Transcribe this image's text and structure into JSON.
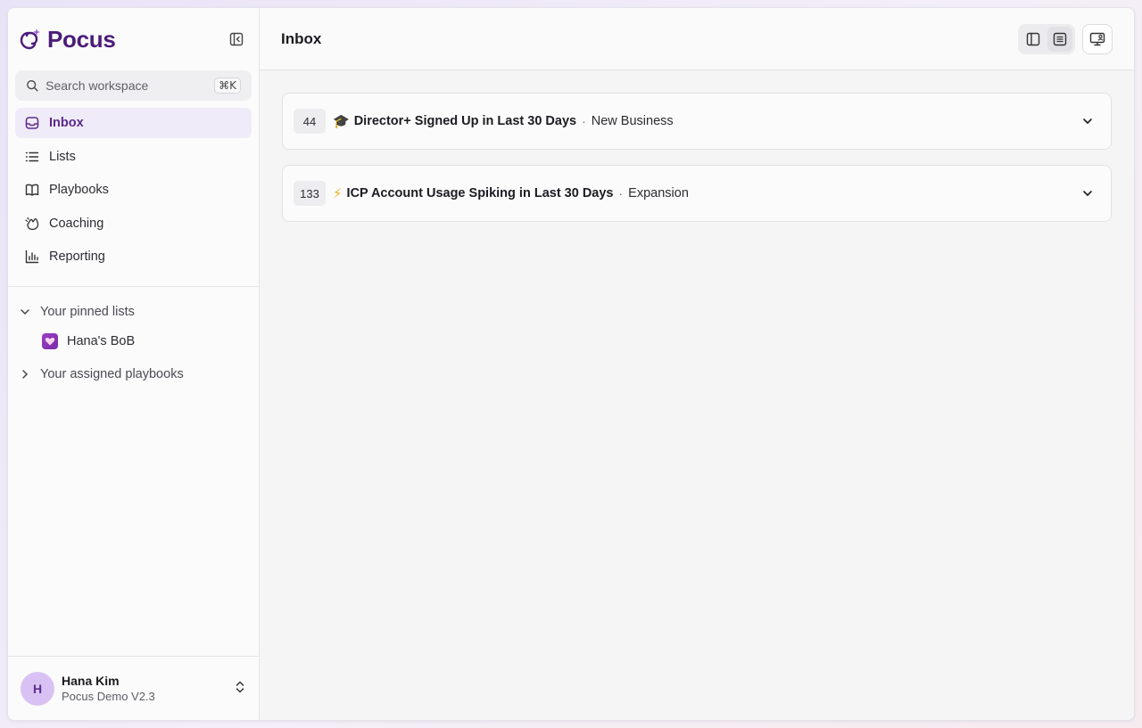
{
  "brand": {
    "name": "Pocus"
  },
  "search": {
    "placeholder": "Search workspace",
    "shortcut": "⌘K"
  },
  "nav": {
    "items": [
      {
        "label": "Inbox",
        "icon": "inbox-icon",
        "active": true
      },
      {
        "label": "Lists",
        "icon": "list-icon",
        "active": false
      },
      {
        "label": "Playbooks",
        "icon": "book-icon",
        "active": false
      },
      {
        "label": "Coaching",
        "icon": "coaching-icon",
        "active": false
      },
      {
        "label": "Reporting",
        "icon": "bar-chart-icon",
        "active": false
      }
    ]
  },
  "sections": {
    "pinned": {
      "label": "Your pinned lists",
      "expanded": true,
      "items": [
        {
          "label": "Hana's BoB",
          "icon": "heart-icon"
        }
      ]
    },
    "assigned": {
      "label": "Your assigned playbooks",
      "expanded": false
    }
  },
  "user": {
    "initial": "H",
    "name": "Hana Kim",
    "org": "Pocus Demo V2.3"
  },
  "header": {
    "title": "Inbox"
  },
  "inbox": {
    "items": [
      {
        "count": "44",
        "emoji": "🎓",
        "title": "Director+ Signed Up in Last 30 Days",
        "separator": "·",
        "category": "New Business"
      },
      {
        "count": "133",
        "emoji": "⚡",
        "title": "ICP Account Usage Spiking in Last 30 Days",
        "separator": "·",
        "category": "Expansion"
      }
    ]
  },
  "colors": {
    "accent": "#4b1c7a",
    "active_bg": "#f0ebf8",
    "avatar_bg": "#d9c2f3"
  }
}
